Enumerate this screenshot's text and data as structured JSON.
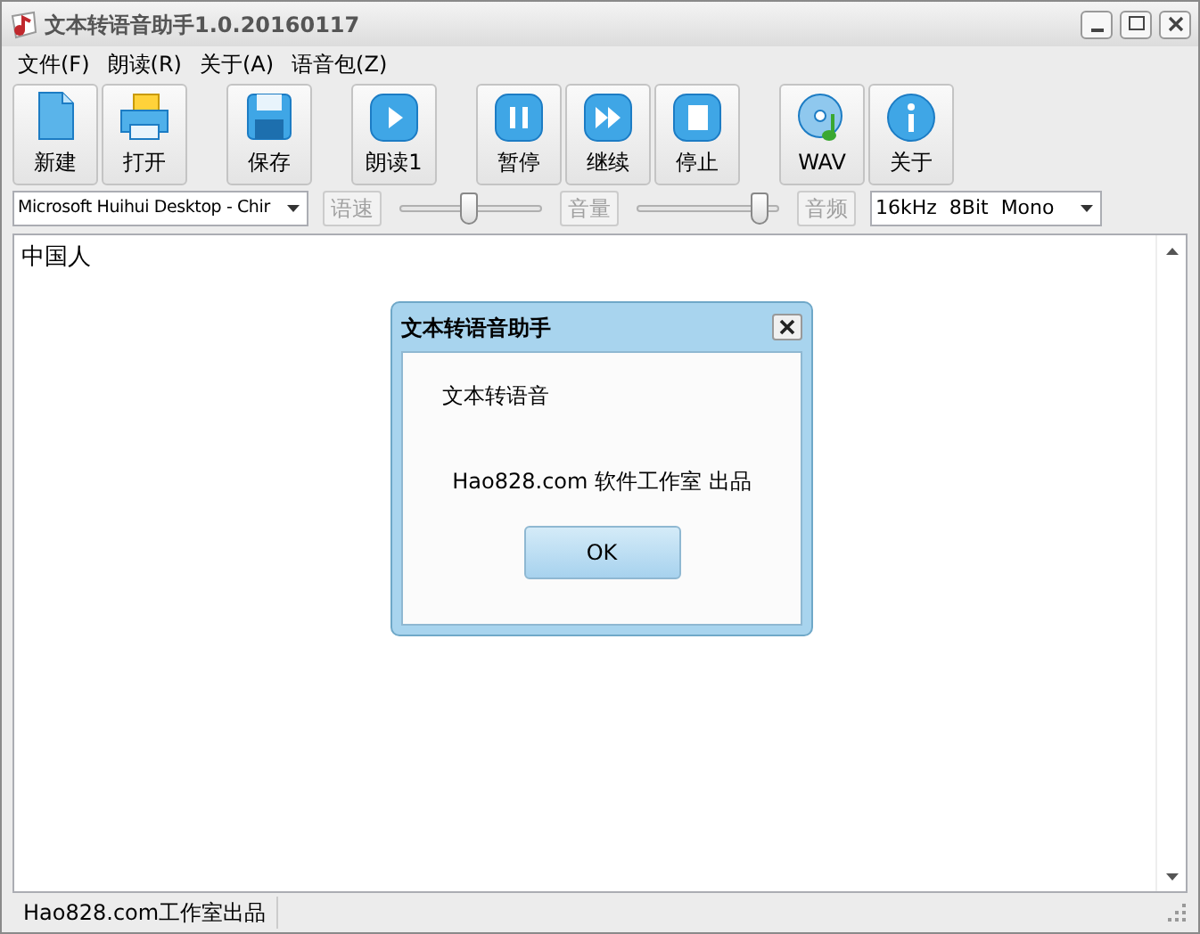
{
  "window": {
    "title": "文本转语音助手1.0.20160117"
  },
  "menu": [
    "文件(F)",
    "朗读(R)",
    "关于(A)",
    "语音包(Z)"
  ],
  "toolbar": [
    [
      {
        "label": "新建"
      },
      {
        "label": "打开"
      }
    ],
    [
      {
        "label": "保存"
      }
    ],
    [
      {
        "label": "朗读1"
      }
    ],
    [
      {
        "label": "暂停"
      },
      {
        "label": "继续"
      },
      {
        "label": "停止"
      }
    ],
    [
      {
        "label": "WAV"
      },
      {
        "label": "关于"
      }
    ]
  ],
  "voice_select": {
    "value": "Microsoft Huihui Desktop - Chir"
  },
  "controls": [
    {
      "kind": "button",
      "label": "语速",
      "disabled": true
    },
    {
      "kind": "slider",
      "level": 0.5
    },
    {
      "kind": "button",
      "label": "音量",
      "disabled": true
    },
    {
      "kind": "slider",
      "level": 0.92
    },
    {
      "kind": "button",
      "label": "音频",
      "disabled": true
    },
    {
      "kind": "select",
      "value": "16kHz  8Bit  Mono"
    }
  ],
  "editor": {
    "text": "中国人"
  },
  "dialog": {
    "title": "文本转语音助手",
    "message": "文本转语音",
    "credit": "Hao828.com 软件工作室 出品",
    "buttons": [
      "OK"
    ]
  },
  "status_bar": {
    "text": "Hao828.com工作室出品"
  }
}
